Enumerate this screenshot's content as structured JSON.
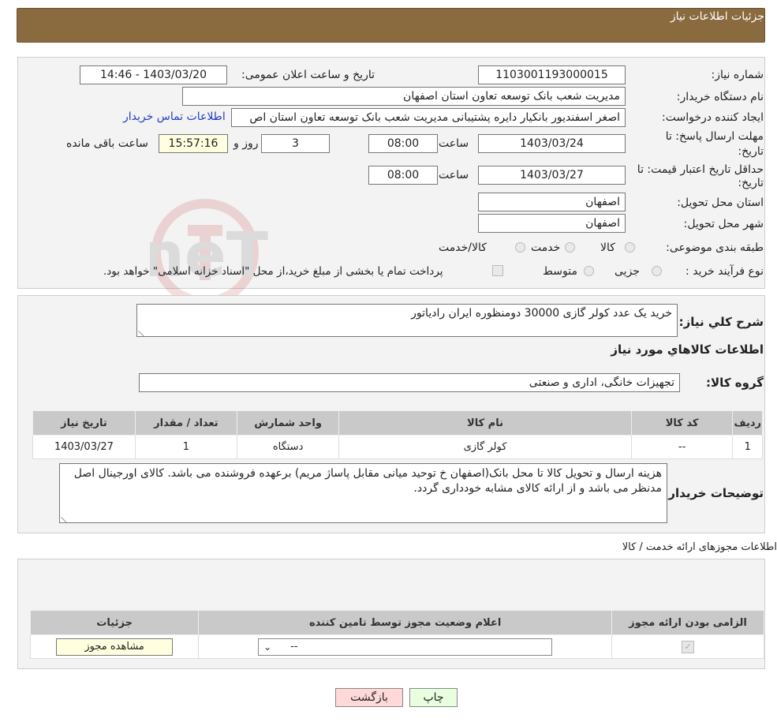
{
  "header": {
    "title": "جزئیات اطلاعات نیاز"
  },
  "form": {
    "need_number_label": "شماره نیاز:",
    "need_number": "1103001193000015",
    "announce_label": "تاریخ و ساعت اعلان عمومی:",
    "announce_value": "1403/03/20 - 14:46",
    "buyer_org_label": "نام دستگاه خریدار:",
    "buyer_org": "مدیریت شعب بانک توسعه تعاون استان اصفهان",
    "creator_label": "ایجاد کننده درخواست:",
    "creator": "اصغر اسفندیور بانکیار دایره پشتیبانی مدیریت شعب بانک توسعه تعاون استان اص",
    "contact_link": "اطلاعات تماس خریدار",
    "deadline_label_1": "مهلت ارسال پاسخ: تا",
    "deadline_label_2": "تاریخ:",
    "deadline_date": "1403/03/24",
    "time_label": "ساعت",
    "deadline_time": "08:00",
    "days_value": "3",
    "days_label": "روز و",
    "remaining_time": "15:57:16",
    "remaining_label": "ساعت باقی مانده",
    "validity_label_1": "حداقل تاریخ اعتبار قیمت: تا",
    "validity_label_2": "تاریخ:",
    "validity_date": "1403/03/27",
    "validity_time": "08:00",
    "province_label": "استان محل تحویل:",
    "province": "اصفهان",
    "city_label": "شهر محل تحویل:",
    "city": "اصفهان",
    "category_label": "طبقه بندی موضوعی:",
    "category_options": [
      "کالا",
      "خدمت",
      "کالا/خدمت"
    ],
    "process_label": "نوع فرآیند خرید :",
    "process_options": [
      "جزیی",
      "متوسط"
    ],
    "payment_note": "پرداخت تمام یا بخشی از مبلغ خرید،از محل \"اسناد خزانه اسلامی\" خواهد بود."
  },
  "details": {
    "summary_label": "شرح کلي نياز:",
    "summary": "خرید یک عدد کولر گازی 30000 دومنظوره ایران رادیاتور",
    "goods_title": "اطلاعات کالاهاي مورد نياز",
    "group_label": "گروه کالا:",
    "group_value": "تجهیزات خانگی، اداری و صنعتی",
    "table_headers": [
      "ردیف",
      "کد کالا",
      "نام کالا",
      "واحد شمارش",
      "تعداد / مقدار",
      "تاریخ نیاز"
    ],
    "table_rows": [
      [
        "1",
        "--",
        "کولر گازی",
        "دستگاه",
        "1",
        "1403/03/27"
      ]
    ],
    "buyer_notes_label": "توضیحات خریدار:",
    "buyer_notes": "هزینه ارسال و تحویل کالا تا محل بانک(اصفهان خ توحید میانی مقابل پاساژ مریم) برعهده فروشنده می باشد. کالای اورجینال اصل مدنظر می باشد و از ارائه کالای مشابه خودداری گردد."
  },
  "licenses": {
    "title": "اطلاعات مجوزهای ارائه خدمت / کالا",
    "headers": [
      "الزامی بودن ارائه مجوز",
      "اعلام وضعیت مجوز توسط تامین کننده",
      "جزئیات"
    ],
    "select_value": "--",
    "view_button": "مشاهده مجوز"
  },
  "buttons": {
    "print": "چاپ",
    "back": "بازگشت"
  },
  "watermark": {
    "text": "AriaTender.neT"
  },
  "colors": {
    "header": "#8a6a3f",
    "link": "#1f3fbf",
    "back_button": "#ffd9d9",
    "print_button": "#e8ffe0",
    "remaining_bg": "#ffffe0"
  }
}
